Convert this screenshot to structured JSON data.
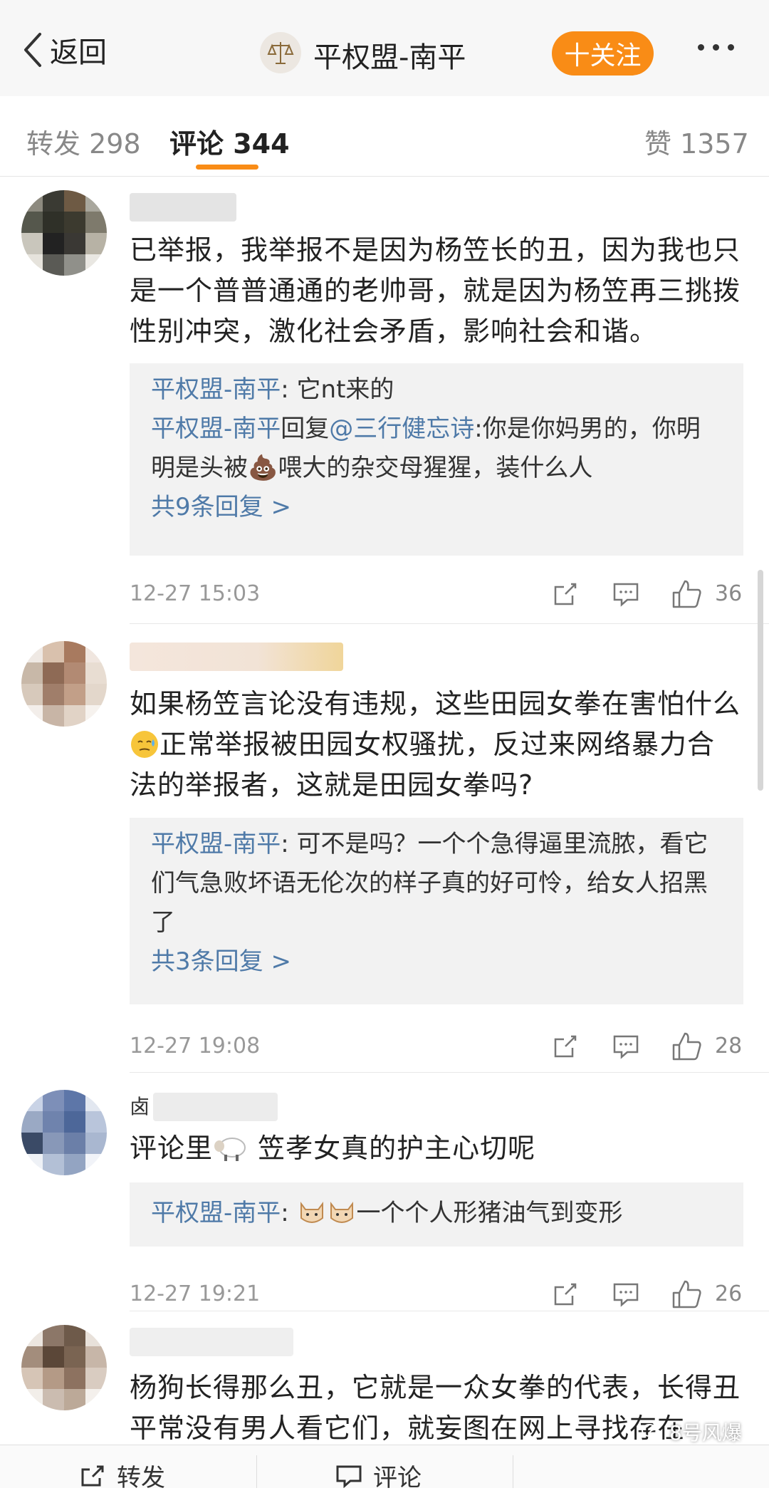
{
  "nav": {
    "back_label": "返回",
    "title": "平权盟-南平",
    "follow_label": "十关注"
  },
  "tabs": [
    {
      "label": "转发 298"
    },
    {
      "label": "评论 344"
    },
    {
      "label": "赞 1357"
    }
  ],
  "comments": [
    {
      "text": "已举报，我举报不是因为杨笠长的丑，因为我也只是一个普普通通的老帅哥，就是因为杨笠再三挑拨性别冲突，激化社会矛盾，影响社会和谐。",
      "replies": [
        {
          "author": "平权盟-南平",
          "content": ": 它nt来的"
        },
        {
          "author": "平权盟-南平",
          "mid": "回复",
          "mention": "@三行健忘诗",
          "content": ":你是你妈男的，你明明是头被💩喂大的杂交母猩猩，装什么人"
        }
      ],
      "more_replies": "共9条回复 >",
      "time": "12-27 15:03",
      "likes": "36"
    },
    {
      "text_a": "如果杨笠言论没有违规，这些田园女拳在害怕什么",
      "text_b": "正常举报被田园女权骚扰，反过来网络暴力合法的举报者，这就是田园女拳吗?",
      "replies": [
        {
          "author": "平权盟-南平",
          "content": ": 可不是吗？一个个急得逼里流脓，看它们气急败坏语无伦次的样子真的好可怜，给女人招黑了"
        }
      ],
      "more_replies": "共3条回复 >",
      "time": "12-27 19:08",
      "likes": "28"
    },
    {
      "username_partial": "卤",
      "text_a": "评论里",
      "text_b": " 笠孝女真的护主心切呢",
      "replies": [
        {
          "author": "平权盟-南平",
          "content": "一个个人形猪油气到变形"
        }
      ],
      "time": "12-27 19:21",
      "likes": "26"
    },
    {
      "text": "杨狗长得那么丑，它就是一众女拳的代表，长得丑平常没有男人看它们，就妄图在网上寻找存在"
    }
  ],
  "bottom_bar": {
    "repost_label": "转发",
    "comment_label": "评论"
  },
  "watermark": "8号风爆",
  "colors": {
    "accent": "#f98c16",
    "link": "#4f7aa8",
    "reply_bg": "#f2f2f2"
  }
}
